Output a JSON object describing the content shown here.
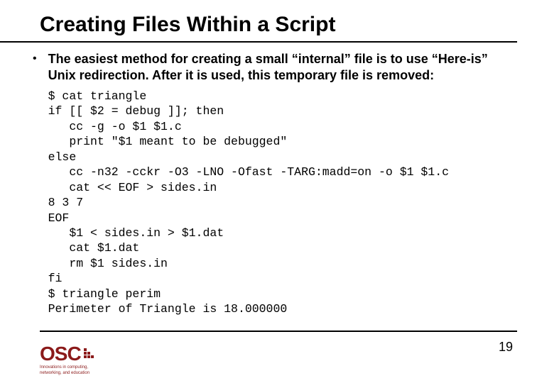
{
  "slide": {
    "title": "Creating Files Within a Script",
    "bullet": "The easiest method for creating a small “internal” file is to use “Here-is” Unix redirection. After it is used, this temporary file is removed:",
    "code": "$ cat triangle\nif [[ $2 = debug ]]; then\n   cc -g -o $1 $1.c\n   print \"$1 meant to be debugged\"\nelse\n   cc -n32 -cckr -O3 -LNO -Ofast -TARG:madd=on -o $1 $1.c\n   cat << EOF > sides.in\n8 3 7\nEOF\n   $1 < sides.in > $1.dat\n   cat $1.dat\n   rm $1 sides.in\nfi\n$ triangle perim\nPerimeter of Triangle is 18.000000",
    "page_number": "19"
  },
  "logo": {
    "text": "OSC",
    "tagline1": "Innovations in computing,",
    "tagline2": "networking, and education"
  }
}
